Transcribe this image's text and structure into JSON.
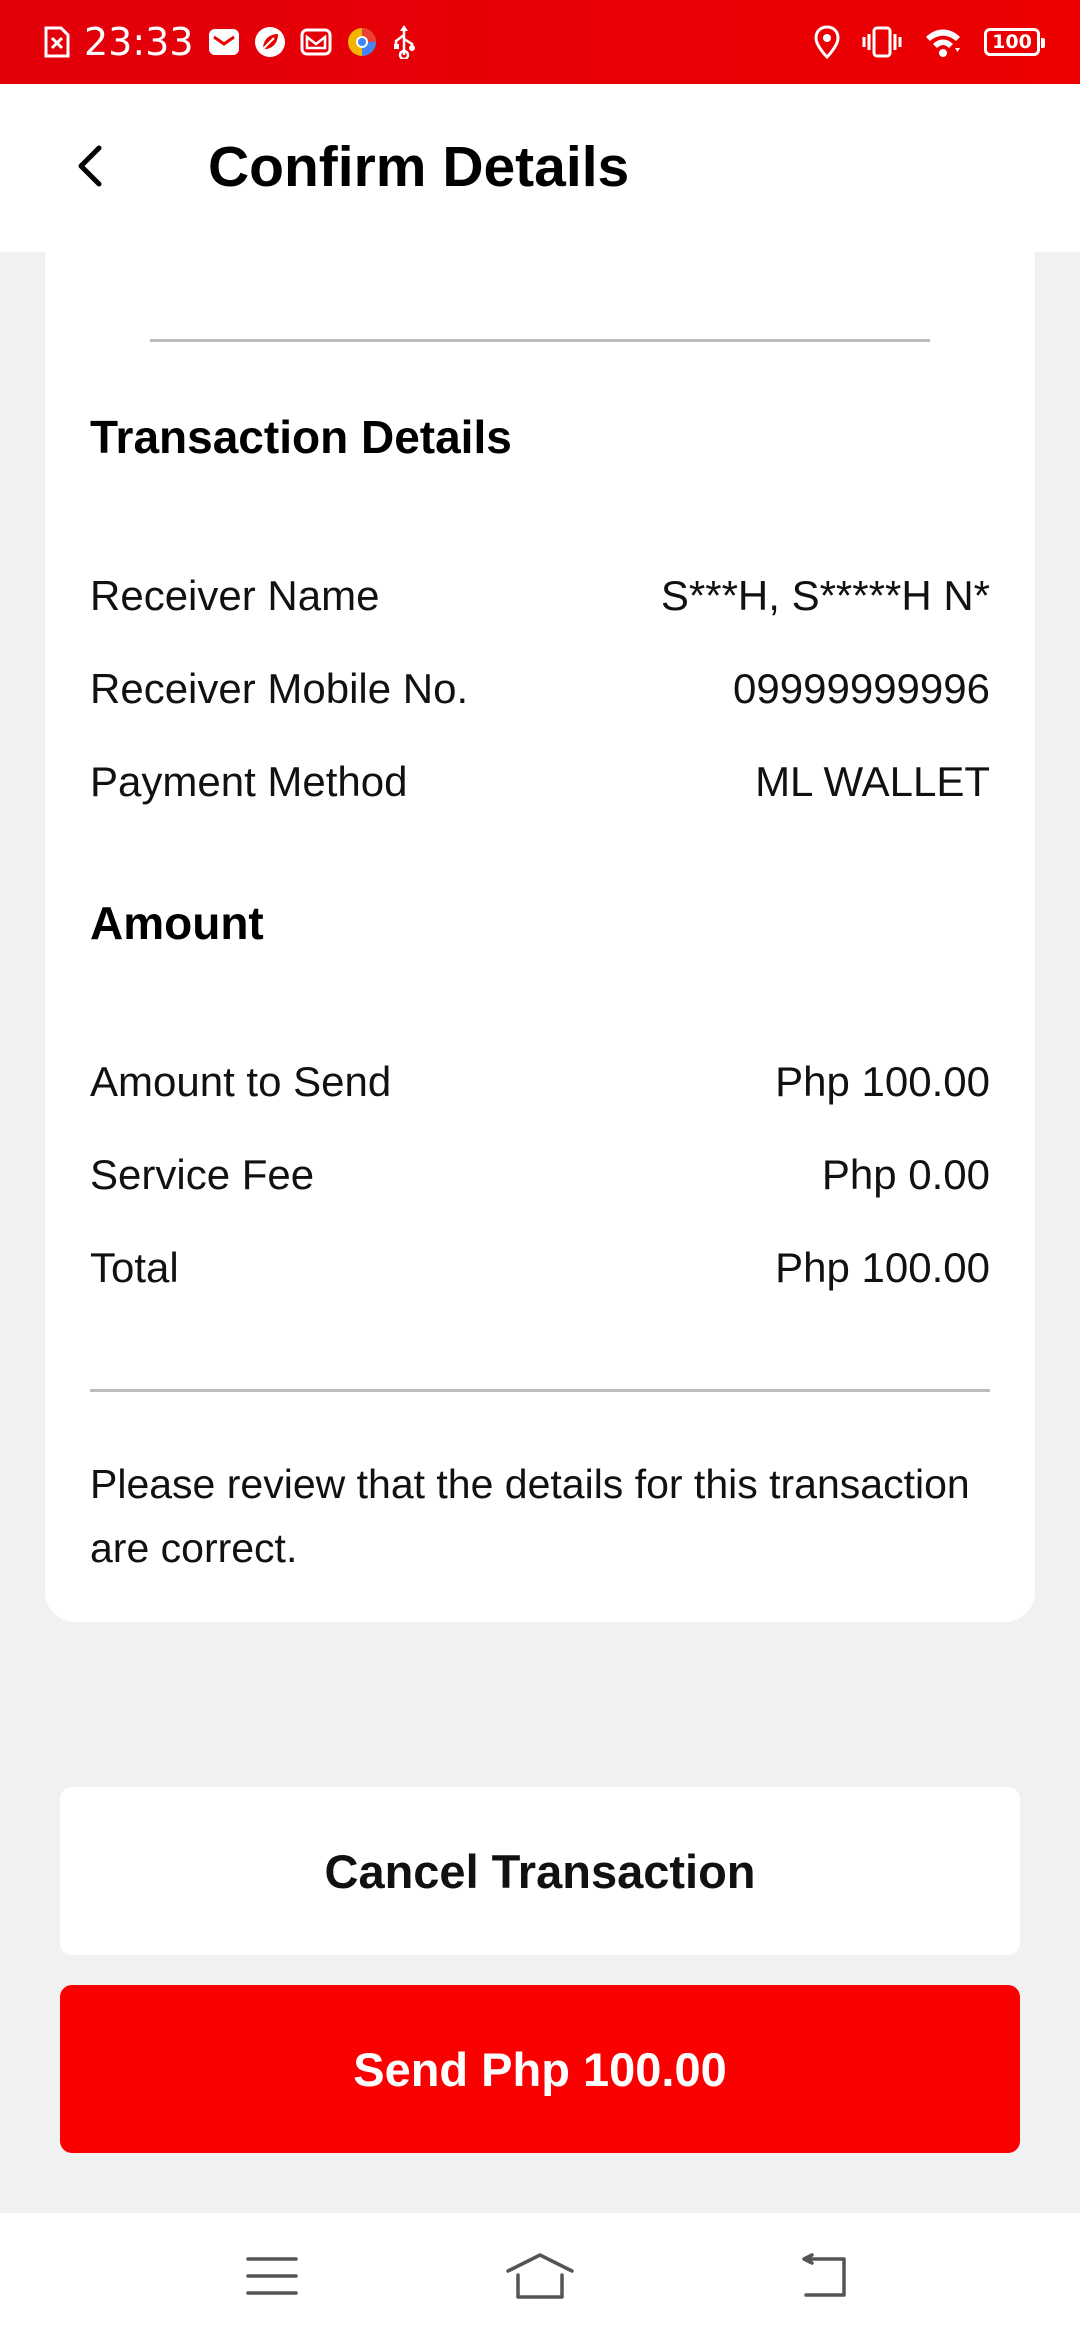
{
  "status_bar": {
    "time": "23:33",
    "battery_level": "100"
  },
  "header": {
    "title": "Confirm Details"
  },
  "transaction_details": {
    "title": "Transaction Details",
    "rows": [
      {
        "label": "Receiver Name",
        "value": "S***H, S*****H N*"
      },
      {
        "label": "Receiver Mobile No.",
        "value": "09999999996"
      },
      {
        "label": "Payment Method",
        "value": "ML WALLET"
      }
    ]
  },
  "amount": {
    "title": "Amount",
    "rows": [
      {
        "label": "Amount to Send",
        "value": "Php 100.00"
      },
      {
        "label": "Service Fee",
        "value": "Php 0.00"
      },
      {
        "label": "Total",
        "value": "Php 100.00"
      }
    ]
  },
  "note": "Please review that the details for this transaction are correct.",
  "buttons": {
    "cancel_label": "Cancel Transaction",
    "send_label": "Send Php 100.00"
  },
  "colors": {
    "status_bar": "#e70000",
    "send_button": "#fb0000",
    "background": "#f1f1f1"
  },
  "icons": {
    "back": "chevron-left-icon",
    "nav_menu": "menu-icon",
    "nav_home": "home-icon",
    "nav_back": "back-icon"
  }
}
